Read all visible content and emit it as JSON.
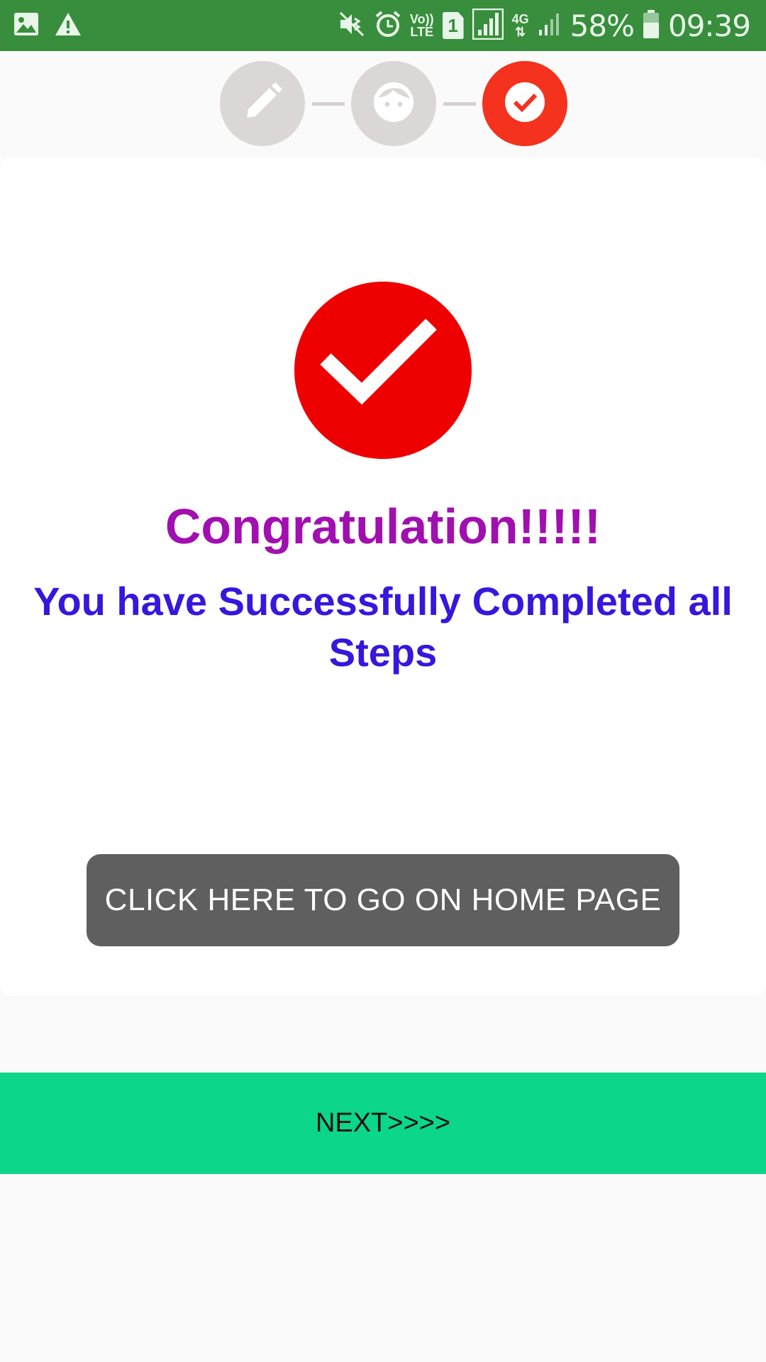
{
  "status_bar": {
    "battery": "58%",
    "time": "09:39",
    "sim_slot": "1",
    "volte_top": "Vo))",
    "volte_bottom": "LTE",
    "network_type": "4G",
    "icons": [
      "image-icon",
      "warning-icon",
      "vibrate-icon",
      "alarm-icon",
      "volte-icon",
      "sim-icon",
      "signal-icon",
      "data-arrows-icon",
      "signal-icon",
      "battery-icon"
    ]
  },
  "stepper": {
    "steps": [
      {
        "icon": "pencil-icon",
        "state": "completed"
      },
      {
        "icon": "face-icon",
        "state": "completed"
      },
      {
        "icon": "check-icon",
        "state": "active"
      }
    ],
    "colors": {
      "inactive": "#dbd7d7",
      "active": "#f4321e"
    }
  },
  "main": {
    "icon": "check-circle-icon",
    "title": "Congratulation!!!!!",
    "message": "You have Successfully Completed all Steps",
    "home_button_label": "CLICK HERE TO GO ON HOME PAGE",
    "colors": {
      "title": "#a10fb0",
      "message": "#3617dc",
      "check": "#ee0000",
      "button": "#5f5f5f"
    }
  },
  "footer": {
    "next_label": "NEXT>>>>",
    "color": "#0cd68a"
  }
}
